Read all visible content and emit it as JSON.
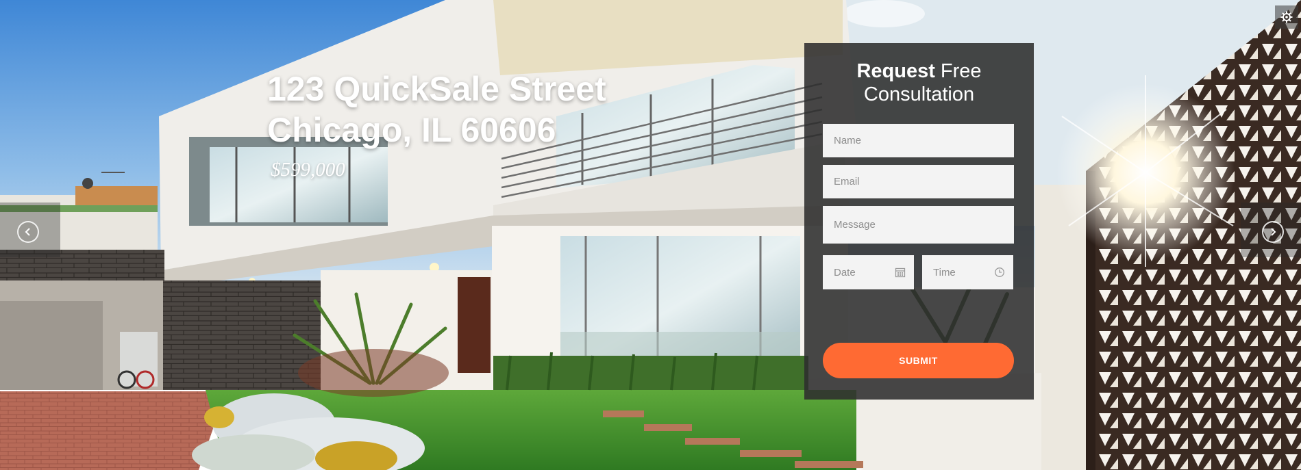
{
  "hero": {
    "address_line1": "123 QuickSale Street",
    "address_line2": "Chicago, IL 60606",
    "price": "$599,000"
  },
  "form": {
    "heading_bold": "Request",
    "heading_light": "Free",
    "heading_line2": "Consultation",
    "name_placeholder": "Name",
    "email_placeholder": "Email",
    "message_placeholder": "Message",
    "date_placeholder": "Date",
    "time_placeholder": "Time",
    "submit_label": "SUBMIT"
  },
  "nav": {
    "prev_icon": "chevron-left-icon",
    "next_icon": "chevron-right-icon",
    "settings_icon": "gear-icon"
  },
  "colors": {
    "accent": "#ff6a33",
    "panel": "#2d2d2d",
    "field_bg": "#f3f3f3"
  }
}
